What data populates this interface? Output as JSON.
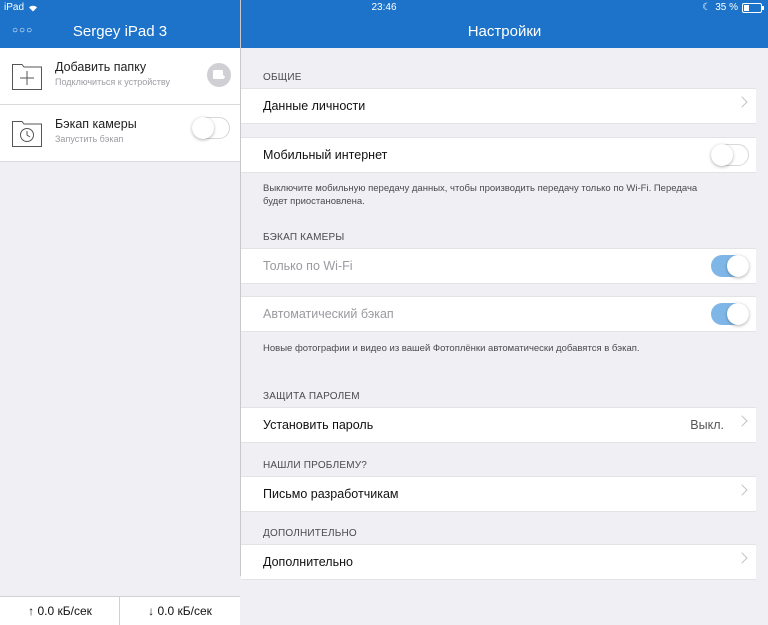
{
  "status": {
    "carrier": "iPad",
    "time": "23:46",
    "battery": "35 %"
  },
  "left": {
    "title": "Sergey iPad 3",
    "items": [
      {
        "name": "Добавить папку",
        "sub": "Подключиться к устройству",
        "icon": "add-folder-icon"
      },
      {
        "name": "Бэкап камеры",
        "sub": "Запустить бэкап",
        "icon": "camera-backup-icon",
        "toggle": false
      }
    ],
    "upload": "0.0 кБ/сек",
    "download": "0.0 кБ/сек"
  },
  "settings": {
    "title": "Настройки",
    "sections": {
      "general": {
        "header": "ОБЩИЕ",
        "identity": "Данные личности",
        "mobile": "Мобильный интернет",
        "mobile_on": false,
        "note": "Выключите мобильную передачу данных, чтобы производить передачу только по Wi-Fi. Передача будет приостановлена."
      },
      "camera": {
        "header": "БЭКАП КАМЕРЫ",
        "wifi_only": "Только по Wi-Fi",
        "wifi_only_on": true,
        "auto": "Автоматический бэкап",
        "auto_on": true,
        "note": "Новые фотографии и видео из вашей Фотоплёнки автоматически добавятся в бэкап."
      },
      "password": {
        "header": "ЗАЩИТА ПАРОЛЕМ",
        "set": "Установить пароль",
        "value": "Выкл."
      },
      "problem": {
        "header": "НАШЛИ ПРОБЛЕМУ?",
        "mail": "Письмо разработчикам"
      },
      "extra": {
        "header": "ДОПОЛНИТЕЛЬНО",
        "item": "Дополнительно"
      }
    }
  },
  "colors": {
    "nav_blue": "#1c73c9",
    "toggle_on": "#7fb6e8"
  }
}
